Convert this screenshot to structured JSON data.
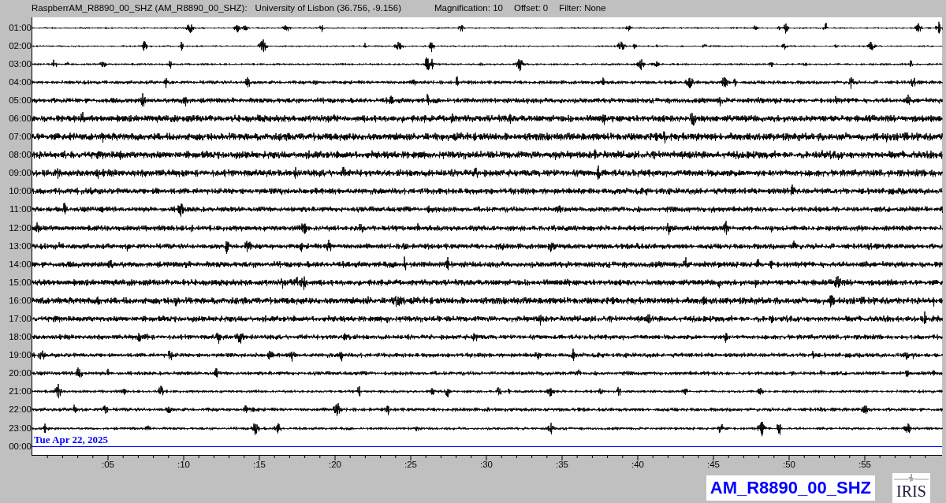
{
  "header": {
    "station": "RaspberrAM_R8890_00_SHZ (AM_R8890_00_SHZ):",
    "location": "University of Lisbon (36.756, -9.156)",
    "magnification": "Magnification: 10",
    "offset": "Offset: 0",
    "filter": "Filter: None"
  },
  "rows": [
    {
      "label": "01:00",
      "kind": "trace"
    },
    {
      "label": "02:00",
      "kind": "trace"
    },
    {
      "label": "03:00",
      "kind": "trace"
    },
    {
      "label": "04:00",
      "kind": "trace"
    },
    {
      "label": "05:00",
      "kind": "trace"
    },
    {
      "label": "06:00",
      "kind": "trace"
    },
    {
      "label": "07:00",
      "kind": "trace"
    },
    {
      "label": "08:00",
      "kind": "trace"
    },
    {
      "label": "09:00",
      "kind": "trace"
    },
    {
      "label": "10:00",
      "kind": "trace"
    },
    {
      "label": "11:00",
      "kind": "trace"
    },
    {
      "label": "12:00",
      "kind": "trace"
    },
    {
      "label": "13:00",
      "kind": "trace"
    },
    {
      "label": "14:00",
      "kind": "trace"
    },
    {
      "label": "15:00",
      "kind": "trace"
    },
    {
      "label": "16:00",
      "kind": "trace"
    },
    {
      "label": "17:00",
      "kind": "trace"
    },
    {
      "label": "18:00",
      "kind": "trace"
    },
    {
      "label": "19:00",
      "kind": "trace"
    },
    {
      "label": "20:00",
      "kind": "trace"
    },
    {
      "label": "21:00",
      "kind": "trace"
    },
    {
      "label": "22:00",
      "kind": "trace"
    },
    {
      "label": "23:00",
      "kind": "trace"
    },
    {
      "label": "00:00",
      "kind": "current"
    }
  ],
  "date": "Tue Apr 22, 2025",
  "x_ticks": [
    ":05",
    ":10",
    ":15",
    ":20",
    ":25",
    ":30",
    ":35",
    ":40",
    ":45",
    ":50",
    ":55"
  ],
  "channel": "AM_R8890_00_SHZ",
  "logo": "IRIS"
}
